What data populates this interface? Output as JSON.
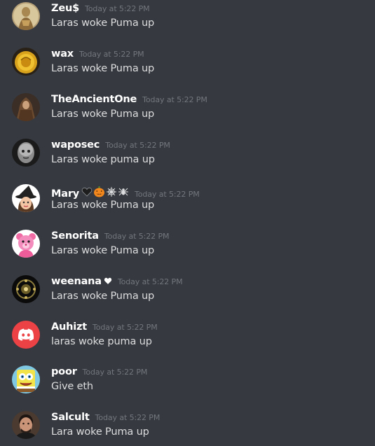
{
  "channel": {
    "messages": [
      {
        "username": "Zeu$",
        "timestamp": "Today at 5:22 PM",
        "content": "Laras woke Puma up",
        "avatar": "gold-statue-avatar"
      },
      {
        "username": "wax",
        "timestamp": "Today at 5:22 PM",
        "content": "Laras woke Puma up",
        "avatar": "gold-coin-avatar"
      },
      {
        "username": "TheAncientOne",
        "timestamp": "Today at 5:22 PM",
        "content": "Laras woke Puma up",
        "avatar": "cloaked-figure-avatar"
      },
      {
        "username": "waposec",
        "timestamp": "Today at 5:22 PM",
        "content": "Laras woke puma up",
        "avatar": "grey-face-avatar"
      },
      {
        "username": "Mary",
        "timestamp": "Today at 5:22 PM",
        "content": "Laras woke Puma up",
        "avatar": "witch-cartoon-avatar",
        "badges": [
          "black-heart-emoji",
          "jack-o-lantern-emoji",
          "spider-web-emoji",
          "spider-emoji"
        ]
      },
      {
        "username": "Senorita",
        "timestamp": "Today at 5:22 PM",
        "content": "Laras woke Puma up",
        "avatar": "pink-teddy-bear-avatar"
      },
      {
        "username": "weenana",
        "timestamp": "Today at 5:22 PM",
        "content": "Laras woke Puma up",
        "avatar": "dark-ornament-avatar",
        "badges": [
          "white-heart-emoji"
        ]
      },
      {
        "username": "Auhizt",
        "timestamp": "Today at 5:22 PM",
        "content": "laras woke puma up",
        "avatar": "discord-default-avatar"
      },
      {
        "username": "poor",
        "timestamp": "Today at 5:22 PM",
        "content": "Give eth",
        "avatar": "spongebob-avatar"
      },
      {
        "username": "Salcult",
        "timestamp": "Today at 5:22 PM",
        "content": "Lara woke Puma up",
        "avatar": "man-photo-avatar"
      }
    ]
  },
  "colors": {
    "background": "#36393f",
    "username": "#ffffff",
    "timestamp": "#72767d",
    "message_text": "#dcddde",
    "discord_red": "#ed4245"
  }
}
